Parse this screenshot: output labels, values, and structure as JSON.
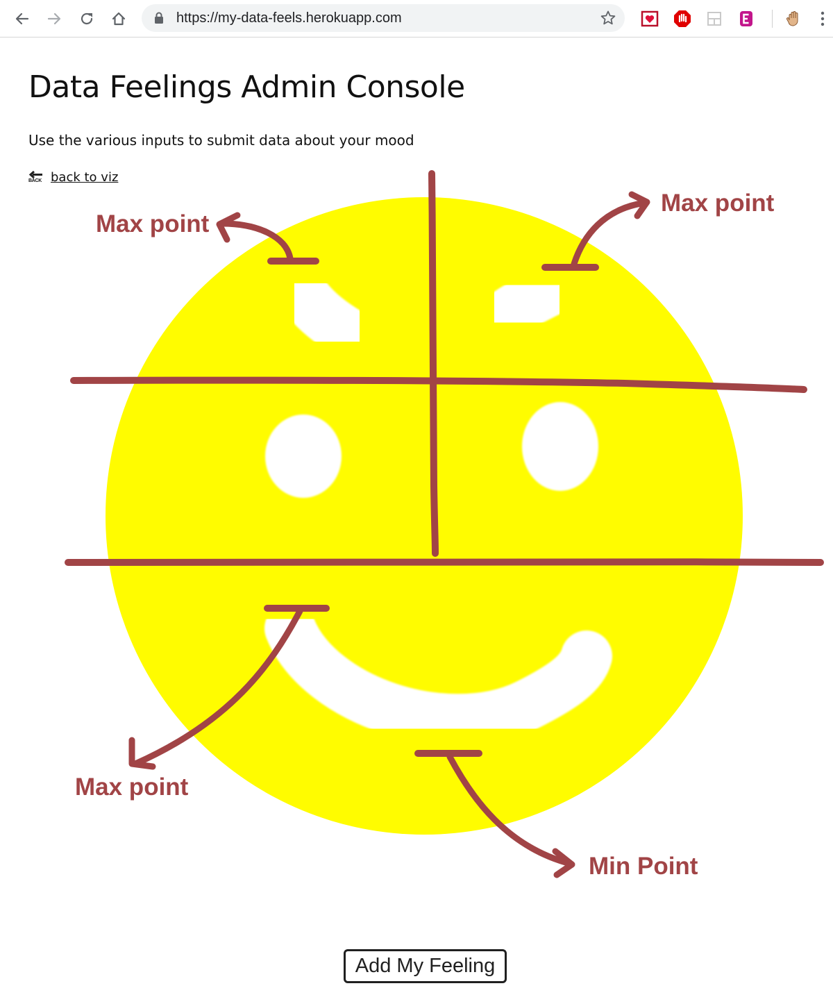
{
  "browser": {
    "url": "https://my-data-feels.herokuapp.com",
    "icons": {
      "back": "arrow-left-icon",
      "forward": "arrow-right-icon",
      "reload": "reload-icon",
      "home": "home-icon",
      "lock": "lock-icon",
      "bookmark": "star-icon",
      "menu": "vertical-dots-icon"
    }
  },
  "page": {
    "title": "Data Feelings Admin Console",
    "subtitle": "Use the various inputs to submit data about your mood",
    "back_link": {
      "icon_text": "BACK",
      "label": "back to viz"
    },
    "annotations": {
      "left_brow": "Max point",
      "right_brow": "Max point",
      "mouth_left": "Max point",
      "mouth_bottom": "Min Point"
    },
    "submit_label": "Add My Feeling"
  },
  "colors": {
    "face": "#fffc00",
    "annotation": "#a14446",
    "feature": "#ffffff",
    "page_background": "#ffffff"
  }
}
